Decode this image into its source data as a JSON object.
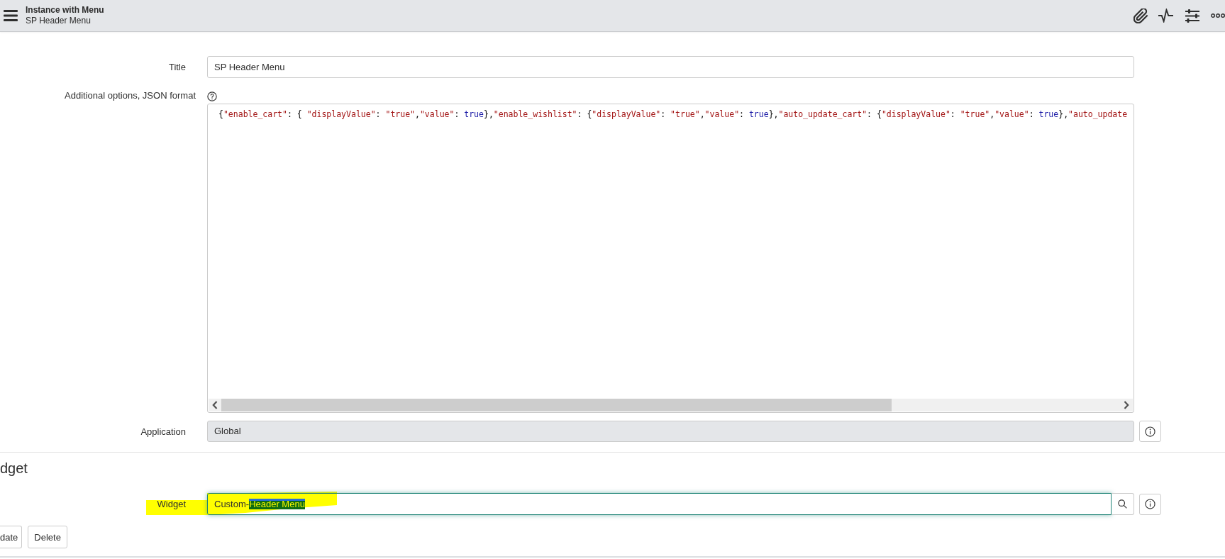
{
  "header": {
    "title": "Instance with Menu",
    "subtitle": "SP Header Menu"
  },
  "fields": [
    {
      "kind": "text",
      "label": "Title",
      "value": "SP Header Menu"
    },
    {
      "kind": "code",
      "label": "Additional options, JSON format",
      "help": true,
      "tokens": [
        {
          "kind": "punct",
          "text": "{"
        },
        {
          "kind": "string",
          "text": "\"enable_cart\""
        },
        {
          "kind": "punct",
          "text": ": { "
        },
        {
          "kind": "string",
          "text": "\"displayValue\""
        },
        {
          "kind": "punct",
          "text": ": "
        },
        {
          "kind": "string",
          "text": "\"true\""
        },
        {
          "kind": "punct",
          "text": ","
        },
        {
          "kind": "string",
          "text": "\"value\""
        },
        {
          "kind": "punct",
          "text": ": "
        },
        {
          "kind": "keyword",
          "text": "true"
        },
        {
          "kind": "punct",
          "text": "},"
        },
        {
          "kind": "string",
          "text": "\"enable_wishlist\""
        },
        {
          "kind": "punct",
          "text": ": {"
        },
        {
          "kind": "string",
          "text": "\"displayValue\""
        },
        {
          "kind": "punct",
          "text": ": "
        },
        {
          "kind": "string",
          "text": "\"true\""
        },
        {
          "kind": "punct",
          "text": ","
        },
        {
          "kind": "string",
          "text": "\"value\""
        },
        {
          "kind": "punct",
          "text": ": "
        },
        {
          "kind": "keyword",
          "text": "true"
        },
        {
          "kind": "punct",
          "text": "},"
        },
        {
          "kind": "string",
          "text": "\"auto_update_cart\""
        },
        {
          "kind": "punct",
          "text": ": {"
        },
        {
          "kind": "string",
          "text": "\"displayValue\""
        },
        {
          "kind": "punct",
          "text": ": "
        },
        {
          "kind": "string",
          "text": "\"true\""
        },
        {
          "kind": "punct",
          "text": ","
        },
        {
          "kind": "string",
          "text": "\"value\""
        },
        {
          "kind": "punct",
          "text": ": "
        },
        {
          "kind": "keyword",
          "text": "true"
        },
        {
          "kind": "punct",
          "text": "},"
        },
        {
          "kind": "string",
          "text": "\"auto_update"
        }
      ]
    },
    {
      "kind": "readonly",
      "label": "Application",
      "value": "Global",
      "info": true
    }
  ],
  "section": {
    "heading": "dget",
    "fields": [
      {
        "kind": "reference",
        "label": "Widget",
        "highlighted": true,
        "focused": true,
        "info": true,
        "value": [
          {
            "text": "Custom-",
            "selected": false
          },
          {
            "text": "Header Menu",
            "selected": true
          }
        ]
      }
    ]
  },
  "buttons": [
    "date",
    "Delete"
  ]
}
